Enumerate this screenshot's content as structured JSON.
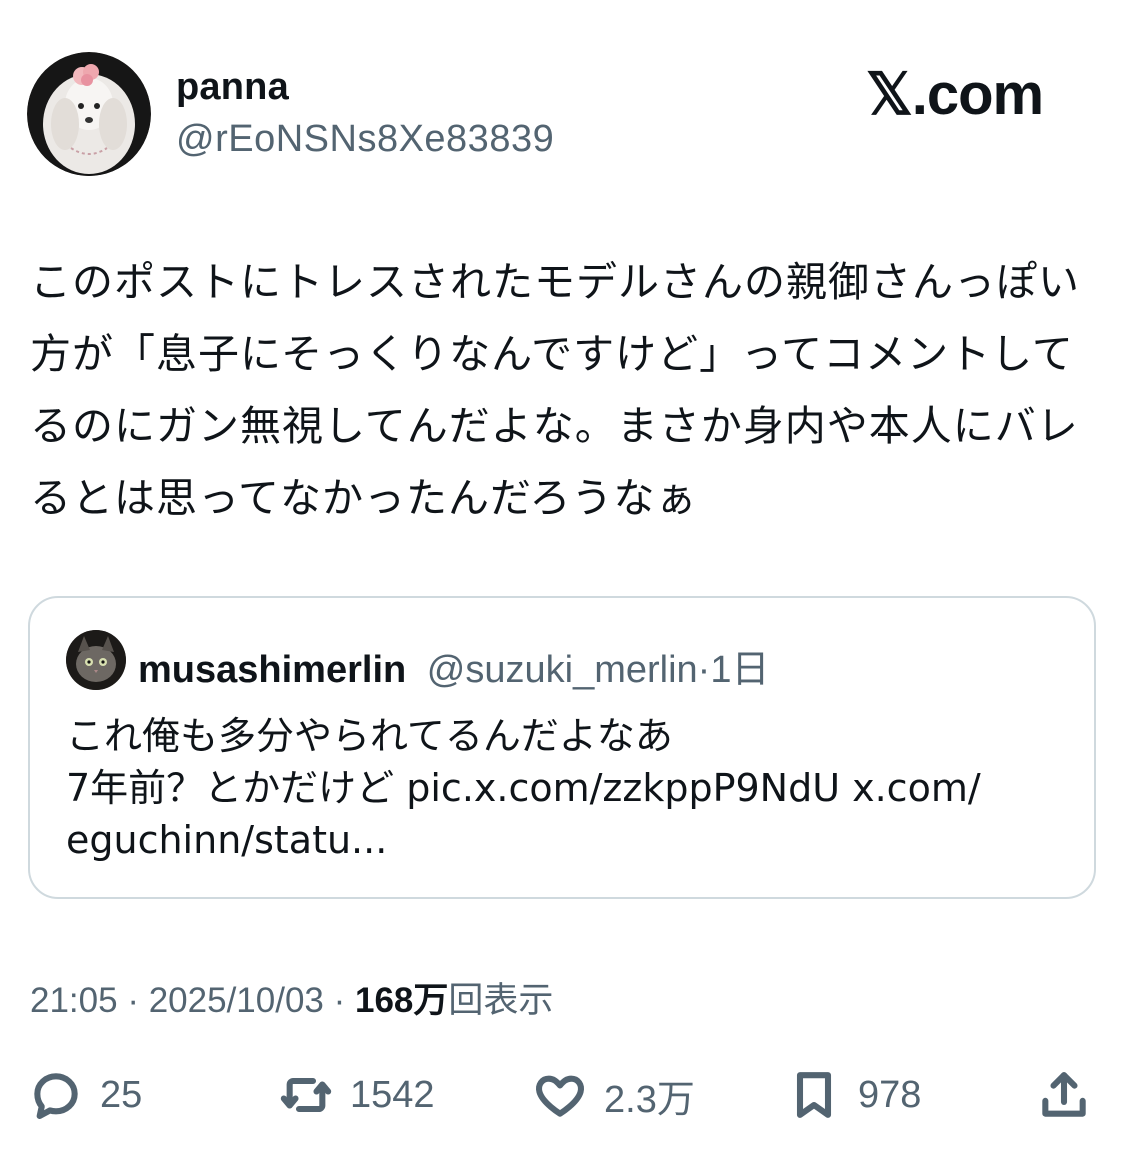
{
  "author": {
    "display_name": "panna",
    "handle": "@rEoNSNs8Xe83839"
  },
  "brand": "𝕏.com",
  "tweet": {
    "text": "このポストにトレスされたモデルさんの親御さんっぽい方が「息子にそっくりなんですけど」ってコメントしてるのにガン無視してんだよな。まさか身内や本人にバレるとは思ってなかったんだろうなぁ"
  },
  "quote": {
    "display_name": "musashimerlin",
    "handle": "@suzuki_merlin",
    "separator": "·",
    "time": "1日",
    "text": "これ俺も多分やられてるんだよなあ\n7年前？とかだけど pic.x.com/zzkppP9NdU x.com/\neguchinn/statu..."
  },
  "meta": {
    "time": "21:05",
    "sep1": " · ",
    "date": "2025/10/03",
    "sep2": " · ",
    "views_count": "168万",
    "views_label": "回表示"
  },
  "actions": {
    "reply": {
      "icon": "reply-icon",
      "count": "25"
    },
    "retweet": {
      "icon": "retweet-icon",
      "count": "1542"
    },
    "like": {
      "icon": "heart-icon",
      "count": "2.3万"
    },
    "bookmark": {
      "icon": "bookmark-icon",
      "count": "978"
    },
    "share": {
      "icon": "share-icon"
    }
  },
  "colors": {
    "text": "#0f1419",
    "secondary": "#536471",
    "border": "#cfd9de"
  }
}
